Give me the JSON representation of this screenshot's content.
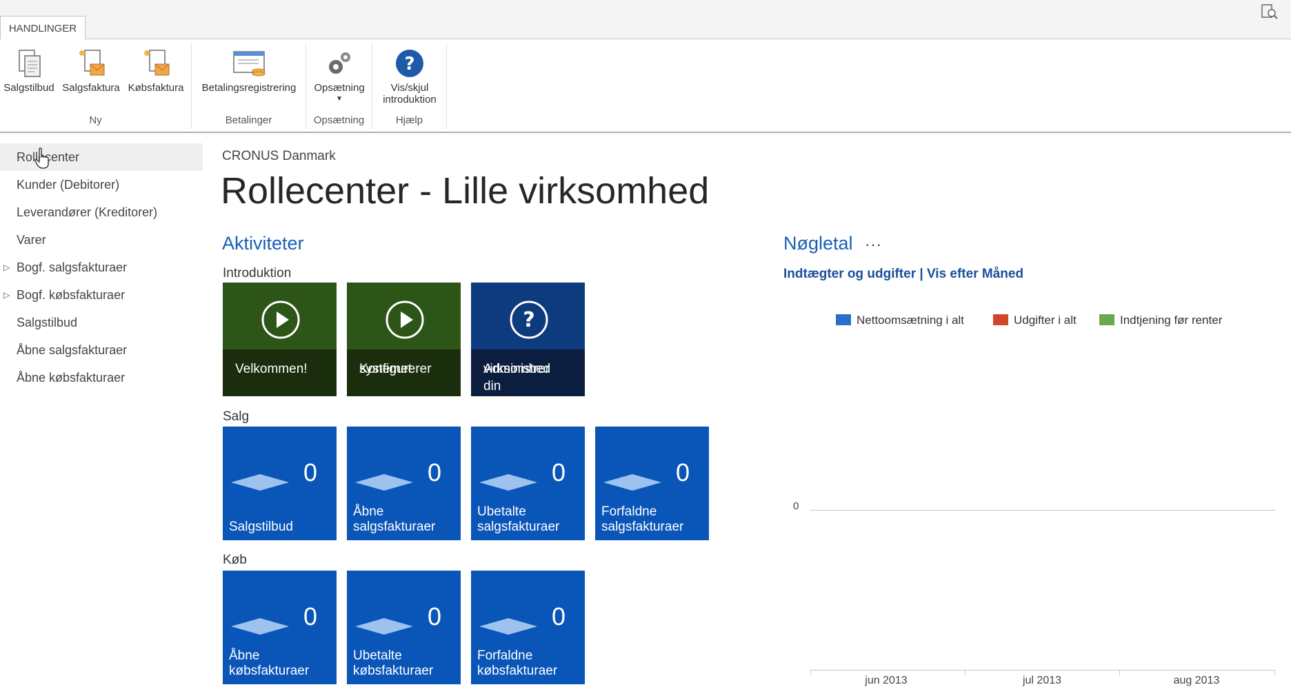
{
  "tabs": {
    "active": "HANDLINGER"
  },
  "ribbon": {
    "groups": [
      {
        "label": "Ny",
        "buttons": [
          "Salgstilbud",
          "Salgsfaktura",
          "Købsfaktura"
        ]
      },
      {
        "label": "Betalinger",
        "buttons": [
          "Betalingsregistrering"
        ]
      },
      {
        "label": "Opsætning",
        "buttons": [
          "Opsætning"
        ]
      },
      {
        "label": "Hjælp",
        "buttons": [
          "Vis/skjul introduktion"
        ]
      }
    ],
    "help_line1": "Vis/skjul",
    "help_line2": "introduktion"
  },
  "nav": {
    "items": [
      "Rollecenter",
      "Kunder (Debitorer)",
      "Leverandører (Kreditorer)",
      "Varer",
      "Bogf. salgsfakturaer",
      "Bogf. købsfakturaer",
      "Salgstilbud",
      "Åbne salgsfakturaer",
      "Åbne købsfakturaer"
    ]
  },
  "main": {
    "company": "CRONUS Danmark",
    "title": "Rollecenter - Lille virksomhed",
    "activities_title": "Aktiviteter",
    "intro_label": "Introduktion",
    "intro_tiles": [
      {
        "line1": "Velkommen!",
        "line2": ""
      },
      {
        "line1": "Konfigurerer",
        "line2": "systemet"
      },
      {
        "line1": "Administrer din",
        "line2": "virksomhed"
      }
    ],
    "sales_label": "Salg",
    "sales_tiles": [
      {
        "count": "0",
        "line1": "Salgstilbud",
        "line2": ""
      },
      {
        "count": "0",
        "line1": "Åbne",
        "line2": "salgsfakturaer"
      },
      {
        "count": "0",
        "line1": "Ubetalte",
        "line2": "salgsfakturaer"
      },
      {
        "count": "0",
        "line1": "Forfaldne",
        "line2": "salgsfakturaer"
      }
    ],
    "purchase_label": "Køb",
    "purchase_tiles": [
      {
        "count": "0",
        "line1": "Åbne",
        "line2": "købsfakturaer"
      },
      {
        "count": "0",
        "line1": "Ubetalte",
        "line2": "købsfakturaer"
      },
      {
        "count": "0",
        "line1": "Forfaldne",
        "line2": "købsfakturaer"
      }
    ]
  },
  "keyfigures": {
    "title": "Nøgletal",
    "dots": "···",
    "subtitle": "Indtægter og udgifter | Vis efter Måned",
    "legend": [
      {
        "label": "Nettoomsætning i alt",
        "color": "#2a6fc9"
      },
      {
        "label": "Udgifter i alt",
        "color": "#d0472a"
      },
      {
        "label": "Indtjening før renter",
        "color": "#6aa84f"
      }
    ],
    "zero_label": "0",
    "x_labels": [
      "jun 2013",
      "jul 2013",
      "aug 2013"
    ]
  },
  "colors": {
    "accent": "#1a5fb4",
    "tile_blue": "#0a55b8",
    "tile_green": "#2c5517",
    "tile_navy": "#0e3a7e"
  }
}
